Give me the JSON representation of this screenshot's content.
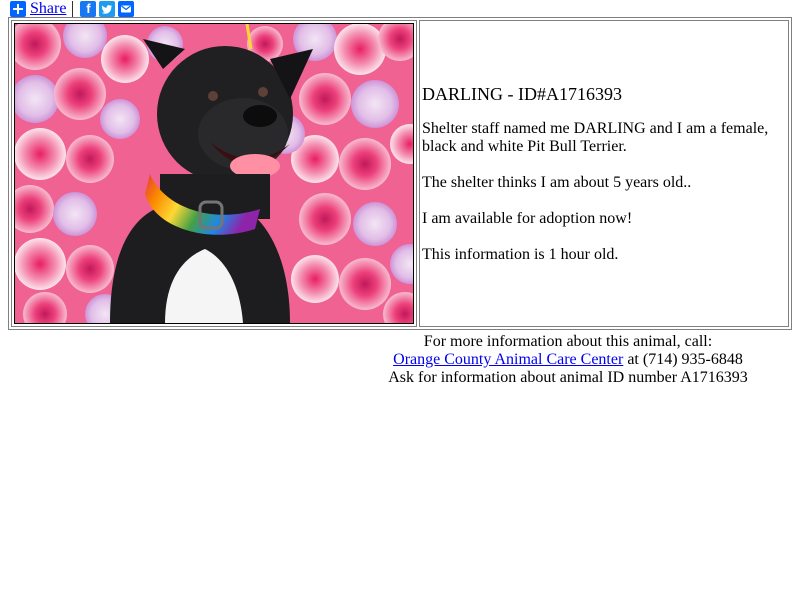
{
  "share_bar": {
    "share_label": "Share",
    "icons": [
      "share-plus-icon",
      "facebook-icon",
      "twitter-icon",
      "email-icon"
    ]
  },
  "listing": {
    "photo_alt": "Photo of DARLING",
    "title": "DARLING - ID#A1716393",
    "paragraphs": [
      "Shelter staff named me DARLING and I am a female, black and white Pit Bull Terrier.",
      "The shelter thinks I am about 5 years old..",
      "I am available for adoption now!",
      "This information is 1 hour old."
    ]
  },
  "contact": {
    "line1": "For more information about this animal, call:",
    "shelter_name": "Orange County Animal Care Center",
    "phone_text": " at (714) 935-6848",
    "line3": "Ask for information about animal ID number A1716393"
  },
  "colors": {
    "link": "#0000ee",
    "share_blue": "#0166ff",
    "facebook": "#1877f2",
    "twitter": "#1d9bf0"
  }
}
